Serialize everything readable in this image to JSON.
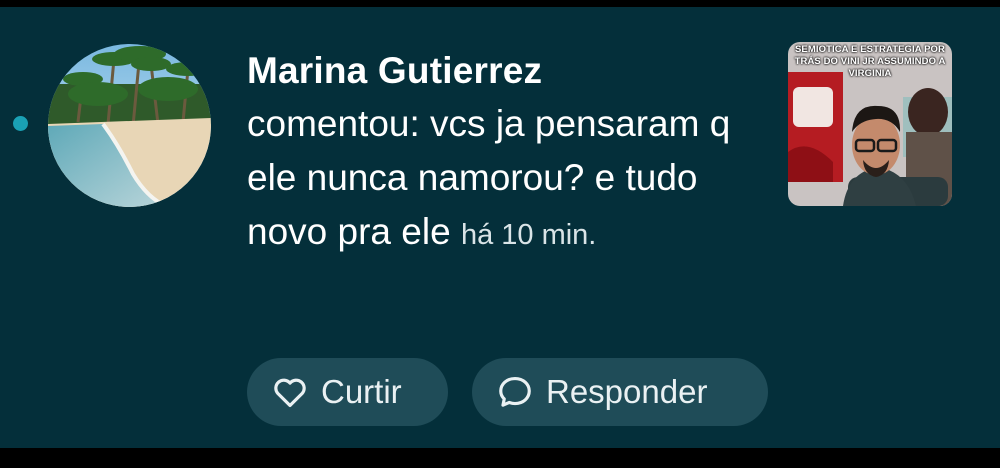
{
  "notification": {
    "author": "Marina Gutierrez",
    "text": "comentou: vcs ja pensaram q ele nunca namorou? e tudo novo pra ele",
    "time": "há 10 min.",
    "unread": true
  },
  "actions": {
    "like_label": "Curtir",
    "reply_label": "Responder"
  },
  "thumbnail": {
    "caption_line1": "SEMIOTICA E ESTRATEGIA POR",
    "caption_line2": "TRÁS DO VINI JR ASSUMINDO A",
    "caption_line3": "VIRGINIA"
  },
  "icons": {
    "like": "heart-outline-icon",
    "reply": "speech-bubble-icon"
  },
  "colors": {
    "background": "#042f3a",
    "pill": "#1f4c58",
    "unread_dot": "#1aa1b5"
  }
}
